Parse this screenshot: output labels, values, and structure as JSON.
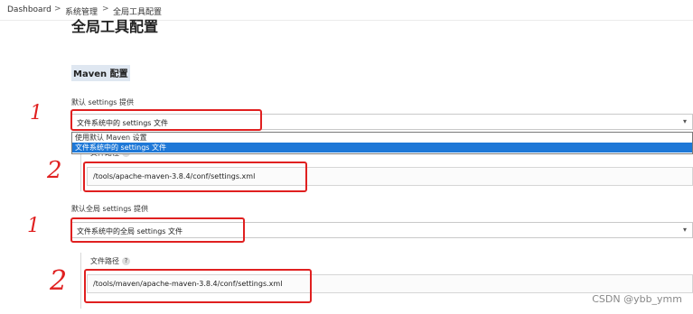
{
  "breadcrumb": {
    "items": [
      "Dashboard",
      "系统管理",
      "全局工具配置"
    ],
    "separator": ">"
  },
  "page": {
    "title": "全局工具配置",
    "section_title": "Maven 配置"
  },
  "settings": {
    "label": "默认 settings 提供",
    "selected": "文件系统中的 settings 文件",
    "options": [
      "使用默认 Maven 设置",
      "文件系统中的 settings 文件"
    ],
    "path_label": "文件路径",
    "path_value": "/tools/apache-maven-3.8.4/conf/settings.xml"
  },
  "global_settings": {
    "label": "默认全局 settings 提供",
    "selected": "文件系统中的全局 settings 文件",
    "path_label": "文件路径",
    "path_value": "/tools/maven/apache-maven-3.8.4/conf/settings.xml"
  },
  "help_icon": "?",
  "annotations": {
    "mark_1": "1",
    "mark_2": "2",
    "color": "#e02020"
  },
  "watermark": "CSDN @ybb_ymm",
  "colors": {
    "section_highlight": "#dfe7f1",
    "selected_option": "#1e78d7"
  }
}
